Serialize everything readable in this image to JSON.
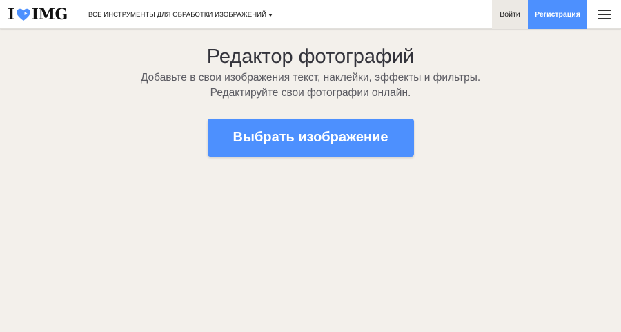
{
  "header": {
    "logo": {
      "left": "I",
      "right": "IMG",
      "heart_color": "#4d90fe"
    },
    "tools_menu_label": "ВСЕ ИНСТРУМЕНТЫ ДЛЯ ОБРАБОТКИ ИЗОБРАЖЕНИЙ",
    "login_label": "Войти",
    "register_label": "Регистрация",
    "menu_icon": "hamburger-icon"
  },
  "main": {
    "title": "Редактор фотографий",
    "subtitle_line1": "Добавьте в свои изображения текст, наклейки, эффекты и фильтры.",
    "subtitle_line2": "Редактируйте свои фотографии онлайн.",
    "select_button_label": "Выбрать изображение"
  },
  "colors": {
    "accent": "#4d90fe",
    "page_background": "#f3f0eb",
    "header_background": "#ffffff"
  }
}
